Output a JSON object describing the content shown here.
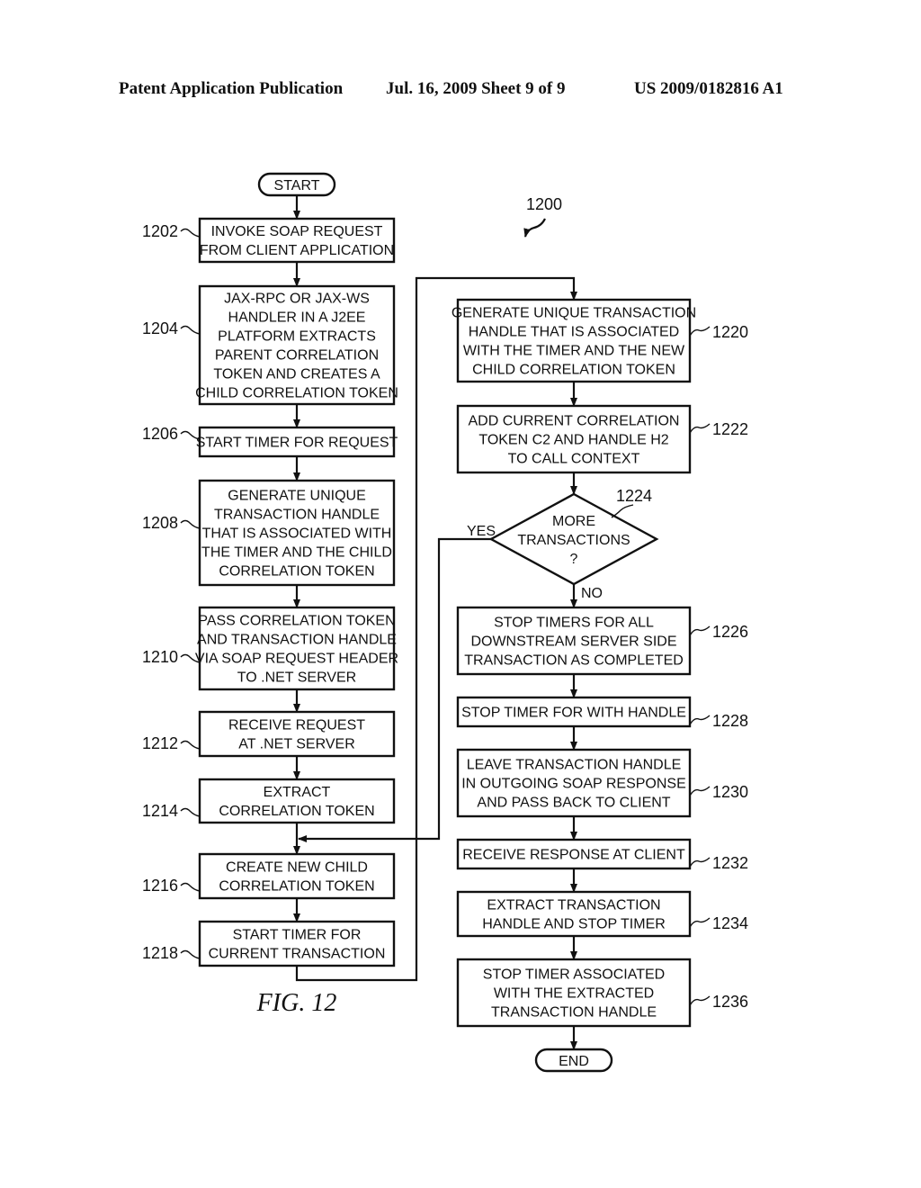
{
  "header": {
    "left": "Patent Application Publication",
    "middle": "Jul. 16, 2009   Sheet 9 of 9",
    "right": "US 2009/0182816 A1"
  },
  "figure": {
    "label": "FIG. 12",
    "reference": "1200"
  },
  "terminals": {
    "start": "START",
    "end": "END"
  },
  "steps": [
    {
      "id": "1202",
      "lines": [
        "INVOKE SOAP REQUEST",
        "FROM CLIENT APPLICATION"
      ]
    },
    {
      "id": "1204",
      "lines": [
        "JAX-RPC OR JAX-WS",
        "HANDLER IN A J2EE",
        "PLATFORM EXTRACTS",
        "PARENT CORRELATION",
        "TOKEN AND CREATES A",
        "CHILD CORRELATION TOKEN"
      ]
    },
    {
      "id": "1206",
      "lines": [
        "START TIMER FOR REQUEST"
      ]
    },
    {
      "id": "1208",
      "lines": [
        "GENERATE UNIQUE",
        "TRANSACTION HANDLE",
        "THAT IS ASSOCIATED WITH",
        "THE TIMER AND THE CHILD",
        "CORRELATION TOKEN"
      ]
    },
    {
      "id": "1210",
      "lines": [
        "PASS CORRELATION TOKEN",
        "AND TRANSACTION HANDLE",
        "VIA SOAP REQUEST HEADER",
        "TO .NET SERVER"
      ]
    },
    {
      "id": "1212",
      "lines": [
        "RECEIVE REQUEST",
        "AT .NET SERVER"
      ]
    },
    {
      "id": "1214",
      "lines": [
        "EXTRACT",
        "CORRELATION TOKEN"
      ]
    },
    {
      "id": "1216",
      "lines": [
        "CREATE NEW CHILD",
        "CORRELATION TOKEN"
      ]
    },
    {
      "id": "1218",
      "lines": [
        "START TIMER FOR",
        "CURRENT TRANSACTION"
      ]
    },
    {
      "id": "1220",
      "lines": [
        "GENERATE UNIQUE TRANSACTION",
        "HANDLE THAT IS ASSOCIATED",
        "WITH THE TIMER AND THE NEW",
        "CHILD CORRELATION TOKEN"
      ]
    },
    {
      "id": "1222",
      "lines": [
        "ADD CURRENT CORRELATION",
        "TOKEN C2 AND HANDLE H2",
        "TO CALL CONTEXT"
      ]
    },
    {
      "id": "1226",
      "lines": [
        "STOP TIMERS FOR ALL",
        "DOWNSTREAM SERVER SIDE",
        "TRANSACTION AS COMPLETED"
      ]
    },
    {
      "id": "1228",
      "lines": [
        "STOP TIMER FOR WITH HANDLE"
      ]
    },
    {
      "id": "1230",
      "lines": [
        "LEAVE TRANSACTION HANDLE",
        "IN OUTGOING SOAP RESPONSE",
        "AND PASS BACK TO CLIENT"
      ]
    },
    {
      "id": "1232",
      "lines": [
        "RECEIVE RESPONSE AT CLIENT"
      ]
    },
    {
      "id": "1234",
      "lines": [
        "EXTRACT TRANSACTION",
        "HANDLE AND STOP TIMER"
      ]
    },
    {
      "id": "1236",
      "lines": [
        "STOP TIMER ASSOCIATED",
        "WITH THE EXTRACTED",
        "TRANSACTION HANDLE"
      ]
    }
  ],
  "decision": {
    "id": "1224",
    "lines": [
      "MORE",
      "TRANSACTIONS",
      "?"
    ],
    "yes_label": "YES",
    "no_label": "NO"
  }
}
